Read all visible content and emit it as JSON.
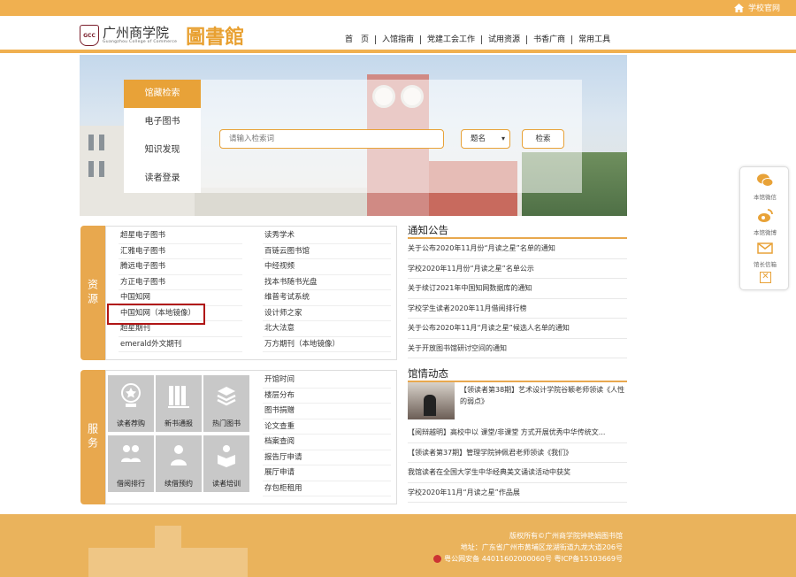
{
  "topbar": {
    "home_label": "学校官网"
  },
  "header": {
    "school_name": "广州商学院",
    "school_sub": "Guangzhou College of Commerce",
    "lib_name": "圖書館",
    "seal": "GCC"
  },
  "nav": [
    "首　页",
    "入馆指南",
    "党建工会工作",
    "试用资源",
    "书香广商",
    "常用工具"
  ],
  "search": {
    "tabs": [
      "馆藏检索",
      "电子图书",
      "知识发现",
      "读者登录"
    ],
    "placeholder": "请输入检索词",
    "select_value": "题名",
    "button": "检索"
  },
  "resources": {
    "title": "资源",
    "col1": [
      "超星电子图书",
      "汇雅电子图书",
      "腾远电子图书",
      "方正电子图书",
      "中国知网",
      "中国知网（本地镜像）",
      "超星期刊",
      "emerald外文期刊"
    ],
    "col2": [
      "读秀学术",
      "百链云图书馆",
      "中经视频",
      "找本书随书光盘",
      "维普考试系统",
      "设计师之家",
      "北大法意",
      "万方期刊（本地镜像）"
    ]
  },
  "services": {
    "title": "服务",
    "tiles": [
      "读者荐购",
      "新书通报",
      "热门图书",
      "借阅排行",
      "续借预约",
      "读者培训"
    ],
    "links": [
      "开馆时间",
      "楼层分布",
      "图书捐赠",
      "论文查重",
      "档案查阅",
      "报告厅申请",
      "展厅申请",
      "存包柜租用"
    ]
  },
  "notices": {
    "title": "通知公告",
    "items": [
      "关于公布2020年11月份“月读之星”名单的通知",
      "学校2020年11月份“月读之星”名单公示",
      "关于续订2021年中国知网数据库的通知",
      "学校学生读者2020年11月借阅排行榜",
      "关于公布2020年11月“月读之星”候选人名单的通知",
      "关于开放图书馆研讨空间的通知"
    ]
  },
  "news": {
    "title": "馆情动态",
    "feature": "【领读者第38期】艺术设计学院谷颖老师领读《人性的弱点》",
    "items": [
      "【阅辩越明】高校中以 课堂/非课堂 方式开展优秀中华传统文...",
      "【领读者第37期】管理学院钟佩君老师领读《我们》",
      "我馆读者在全国大学生中华经典美文诵读活动中获奖",
      "学校2020年11月“月读之星”作品展"
    ]
  },
  "footer": {
    "copyright": "版权所有©广州商学院钟艳娟图书馆",
    "address": "地址：广东省广州市黄埔区龙湖街道九龙大道206号",
    "icp": "粤公网安备 44011602000060号 粤ICP备15103669号"
  },
  "float": {
    "wechat": "本馆微信",
    "weibo": "本馆微博",
    "mail": "馆长信箱"
  },
  "colors": {
    "accent": "#e8a84e",
    "topbar": "#f0b050",
    "highlight": "#b01515"
  }
}
